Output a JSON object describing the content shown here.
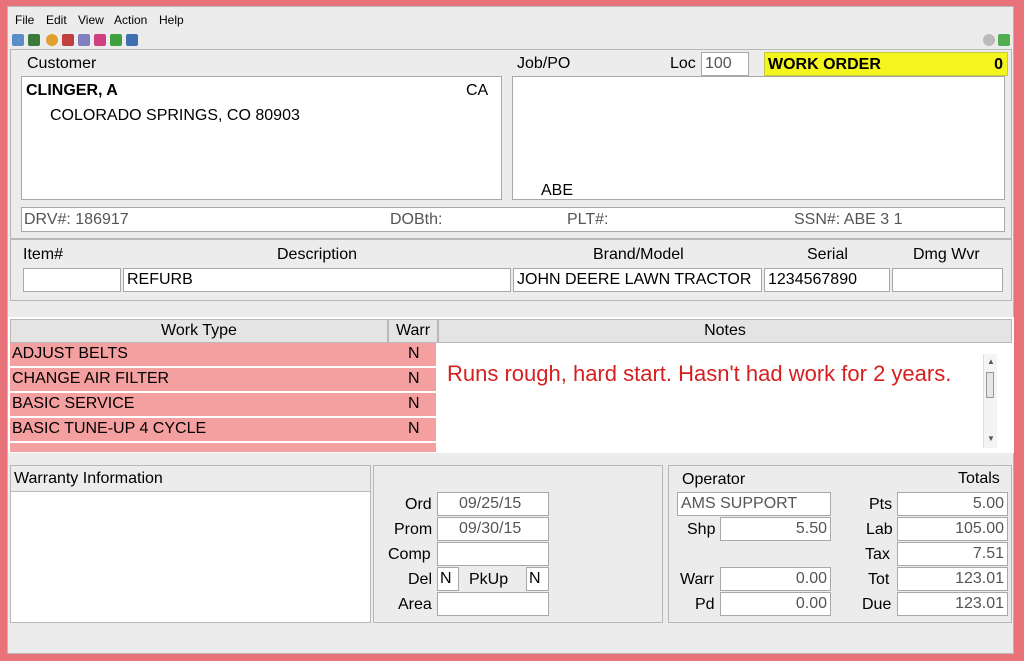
{
  "menu": {
    "file": "File",
    "edit": "Edit",
    "view": "View",
    "action": "Action",
    "help": "Help"
  },
  "toolbar_icons": [
    "new-icon",
    "export-icon",
    "person-icon",
    "flag-icon",
    "checklist-icon",
    "stamp-icon",
    "gift-icon",
    "chart-icon",
    "refresh-icon",
    "arrow-up-icon"
  ],
  "customer": {
    "label": "Customer",
    "name": "CLINGER, A",
    "state_code": "CA",
    "address": "COLORADO SPRINGS, CO  80903"
  },
  "job": {
    "label": "Job/PO",
    "loc_label": "Loc",
    "loc_value": "100",
    "text": "ABE"
  },
  "work_order": {
    "label": "WORK ORDER",
    "number": "0"
  },
  "id_line": {
    "drv": "DRV#: 186917",
    "dob": "DOBth:",
    "plt": "PLT#:",
    "ssn": "SSN#: ABE 3 1"
  },
  "item": {
    "headers": {
      "item": "Item#",
      "description": "Description",
      "brand": "Brand/Model",
      "serial": "Serial",
      "dmg": "Dmg Wvr"
    },
    "values": {
      "item": "",
      "description": "REFURB",
      "brand": "JOHN DEERE LAWN TRACTOR",
      "serial": "1234567890",
      "dmg": ""
    }
  },
  "work_types": {
    "header": "Work Type",
    "warr_header": "Warr",
    "rows": [
      {
        "name": "ADJUST BELTS",
        "warr": "N"
      },
      {
        "name": "CHANGE AIR FILTER",
        "warr": "N"
      },
      {
        "name": "BASIC SERVICE",
        "warr": "N"
      },
      {
        "name": "BASIC TUNE-UP 4 CYCLE",
        "warr": "N"
      }
    ]
  },
  "notes": {
    "header": "Notes",
    "text": "Runs rough, hard start.  Hasn't had work for 2 years."
  },
  "warranty": {
    "label": "Warranty Information"
  },
  "dates": {
    "ord_label": "Ord",
    "ord": "09/25/15",
    "prom_label": "Prom",
    "prom": "09/30/15",
    "comp_label": "Comp",
    "comp": "",
    "del_label": "Del",
    "del": "N",
    "pkup_label": "PkUp",
    "pkup": "N",
    "area_label": "Area",
    "area": ""
  },
  "operator": {
    "label": "Operator",
    "value": "AMS SUPPORT",
    "shp_label": "Shp",
    "shp": "5.50",
    "warr_label": "Warr",
    "warr": "0.00",
    "pd_label": "Pd",
    "pd": "0.00"
  },
  "totals": {
    "label": "Totals",
    "pts_label": "Pts",
    "pts": "5.00",
    "lab_label": "Lab",
    "lab": "105.00",
    "tax_label": "Tax",
    "tax": "7.51",
    "tot_label": "Tot",
    "tot": "123.01",
    "due_label": "Due",
    "due": "123.01"
  },
  "colors": {
    "frame": "#e8727a",
    "work_order_bg": "#f4f41e",
    "work_type_row": "#f4a0a0",
    "notes_text": "#d42020"
  }
}
